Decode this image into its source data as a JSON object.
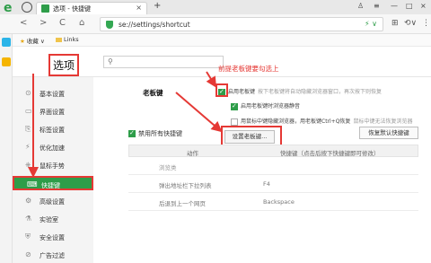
{
  "tabbar": {
    "tab_title": "选项 - 快捷键",
    "close_glyph": "×",
    "add_glyph": "+",
    "icons": [
      "e-browser-logo",
      "back-circle-icon",
      "shirt-icon",
      "menu-icon",
      "minimize-icon",
      "maximize-icon",
      "close-icon"
    ]
  },
  "addressbar": {
    "back_glyph": "<",
    "forward_glyph": ">",
    "refresh_glyph": "C",
    "home_glyph": "⌂",
    "url": "se://settings/shortcut",
    "dropdown_glyph": "⚡ ∨",
    "tools": [
      "⊞",
      "⟲∨",
      "⋮"
    ]
  },
  "bookmarks": {
    "fav_label": "收藏",
    "chevron": "∨",
    "links_label": "Links"
  },
  "settings": {
    "title": "选项",
    "search_placeholder": "",
    "search_icon": "search-icon",
    "sidebar": [
      {
        "icon": "⊙",
        "label": "基本设置"
      },
      {
        "icon": "▭",
        "label": "界面设置"
      },
      {
        "icon": "⎘",
        "label": "标签设置"
      },
      {
        "icon": "⚡",
        "label": "优化加速"
      },
      {
        "icon": "⎈",
        "label": "鼠标手势"
      },
      {
        "icon": "⌨",
        "label": "快捷键"
      },
      {
        "icon": "⚙",
        "label": "高级设置"
      },
      {
        "icon": "⚗",
        "label": "实验室"
      },
      {
        "icon": "⛨",
        "label": "安全设置"
      },
      {
        "icon": "⊘",
        "label": "广告过滤"
      }
    ],
    "active_index": 5
  },
  "boss_key": {
    "section_title": "老板键",
    "annotation": "前提老板键要勾选上",
    "options": [
      {
        "checked": true,
        "label": "启用老板键",
        "hint": "按下老板键将自动隐藏浏览器窗口，再次按下则恢复"
      },
      {
        "checked": true,
        "label": "启用老板键时浏览器静音",
        "hint": ""
      },
      {
        "checked": false,
        "label": "用鼠标中键隐藏浏览器，用老板键Ctrl+Q恢复",
        "hint": "鼠标中键无法恢复浏览器"
      }
    ],
    "set_button": "设置老板键..."
  },
  "shortcuts": {
    "disable_all": "禁用所有快捷键",
    "disable_checked": true,
    "restore_default": "恢复默认快捷键",
    "columns": [
      "动作",
      "快捷键（点击后按下快捷键即可修改）"
    ],
    "rows": [
      {
        "action": "浏览类",
        "key": "",
        "group": true
      },
      {
        "action": "弹出地址栏下拉列表",
        "key": "F4",
        "group": false
      },
      {
        "action": "后退到上一个网页",
        "key": "Backspace",
        "group": false
      }
    ]
  },
  "colors": {
    "accent_green": "#2e9d49",
    "annotation_red": "#e53935"
  }
}
